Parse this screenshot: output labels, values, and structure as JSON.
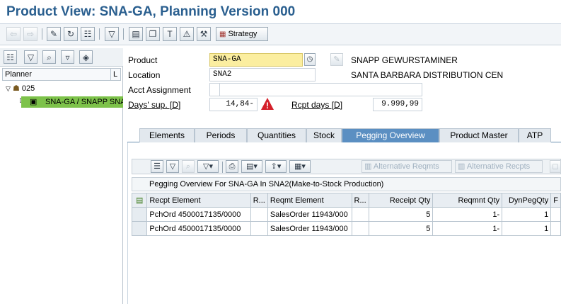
{
  "window": {
    "title": "Product View: SNA-GA, Planning Version 000"
  },
  "toolbar": {
    "strategy_label": "Strategy"
  },
  "tree": {
    "column_planner": "Planner",
    "column_l": "L",
    "node_planner": "025",
    "node_product": "SNA-GA / SNAPP SNAPP GEWURSTAMINER"
  },
  "header": {
    "product_label": "Product",
    "product_value": "SNA-GA",
    "product_desc": "SNAPP GEWURSTAMINER",
    "location_label": "Location",
    "location_value": "SNA2",
    "location_desc": "SANTA BARBARA DISTRIBUTION CEN",
    "acct_label": "Acct Assignment",
    "acct_value": "",
    "days_label": "Days' sup. [D]",
    "days_value": "14,84-",
    "rcpt_label": "Rcpt days [D]",
    "rcpt_value": "9.999,99"
  },
  "tabs": [
    {
      "label": "Elements"
    },
    {
      "label": "Periods"
    },
    {
      "label": "Quantities"
    },
    {
      "label": "Stock"
    },
    {
      "label": "Pegging Overview"
    },
    {
      "label": "Product Master"
    },
    {
      "label": "ATP"
    }
  ],
  "grid": {
    "alt_reqmts": "Alternative Reqmts",
    "alt_recpts": "Alternative Recpts",
    "title": "Pegging Overview For SNA-GA In SNA2(Make-to-Stock Production)",
    "columns": [
      "Recpt Element",
      "R...",
      "Reqmt Element",
      "R...",
      "Receipt Qty",
      "Reqmnt Qty",
      "DynPegQty",
      "F"
    ],
    "rows": [
      [
        "PchOrd 4500017135/0000",
        "",
        "SalesOrder 11943/000",
        "",
        "5",
        "1-",
        "1",
        ""
      ],
      [
        "PchOrd 4500017135/0000",
        "",
        "SalesOrder 11943/000",
        "",
        "5",
        "1-",
        "1",
        ""
      ]
    ]
  }
}
